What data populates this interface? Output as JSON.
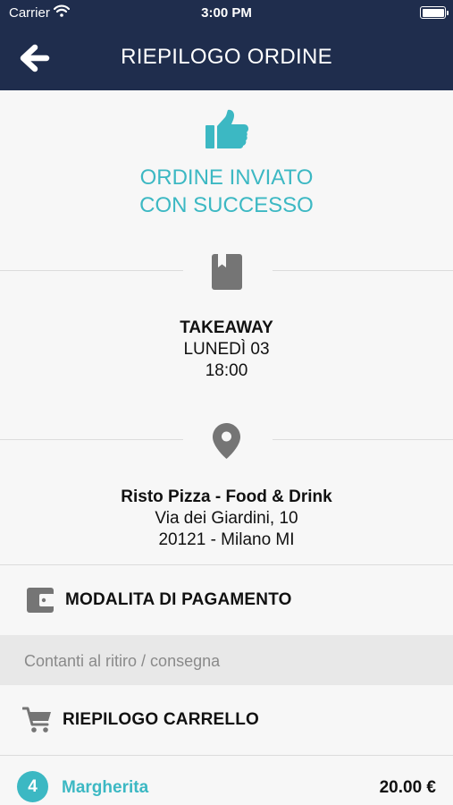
{
  "status_bar": {
    "carrier": "Carrier",
    "time": "3:00 PM"
  },
  "nav": {
    "title": "RIEPILOGO ORDINE",
    "back_icon": "arrow-left-icon"
  },
  "success": {
    "line1": "ORDINE INVIATO",
    "line2": "CON SUCCESSO",
    "icon": "thumbs-up-icon",
    "color": "#3cb8c3"
  },
  "order_type": {
    "icon": "book-icon",
    "type": "TAKEAWAY",
    "day": "LUNEDÌ 03",
    "time": "18:00"
  },
  "location": {
    "icon": "map-pin-icon",
    "name": "Risto Pizza - Food & Drink",
    "address": "Via dei Giardini, 10",
    "city": "20121 - Milano MI"
  },
  "payment": {
    "icon": "wallet-icon",
    "title": "MODALITA DI PAGAMENTO",
    "method": "Contanti al ritiro / consegna"
  },
  "cart": {
    "icon": "cart-icon",
    "title": "RIEPILOGO CARRELLO",
    "items": [
      {
        "qty": "4",
        "name": "Margherita",
        "price": "20.00 €"
      }
    ]
  },
  "colors": {
    "header_bg": "#1f2d4d",
    "accent": "#3cb8c3",
    "icon_gray": "#757575"
  }
}
